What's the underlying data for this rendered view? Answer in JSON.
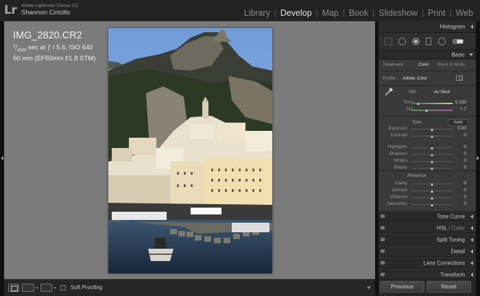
{
  "app": {
    "logo": "Lr",
    "name": "Adobe Lightroom Classic CC",
    "user": "Shannon Ciricillo"
  },
  "modules": [
    {
      "label": "Library",
      "active": false
    },
    {
      "label": "Develop",
      "active": true
    },
    {
      "label": "Map",
      "active": false
    },
    {
      "label": "Book",
      "active": false
    },
    {
      "label": "Slideshow",
      "active": false
    },
    {
      "label": "Print",
      "active": false
    },
    {
      "label": "Web",
      "active": false
    }
  ],
  "image_info": {
    "filename": "IMG_2820.CR2",
    "shutter_numerator": "1",
    "shutter_denominator": "4000",
    "exposure_rest": " sec at ƒ / 5.6, ISO 640",
    "lens": "50 mm (EF50mm f/1.8 STM)"
  },
  "toolbar": {
    "soft_proofing_label": "Soft Proofing",
    "soft_proofing_checked": false
  },
  "panel": {
    "histogram": "Histogram",
    "basic": "Basic",
    "treatment_label": "Treatment :",
    "treatment_options": [
      "Color",
      "Black & White"
    ],
    "treatment_selected": "Color",
    "profile_label": "Profile :",
    "profile_value": "Adobe Color",
    "wb_label": "WB :",
    "wb_value": "As Shot",
    "temp_label": "Temp",
    "temp_value": "5,150",
    "tint_label": "Tint",
    "tint_value": "+ 7",
    "tone_label": "Tone",
    "auto_label": "Auto",
    "tone_sliders": [
      {
        "label": "Exposure",
        "value": "0.00",
        "position": 0.5
      },
      {
        "label": "Contrast",
        "value": "0",
        "position": 0.5
      },
      {
        "label": "Highlights",
        "value": "0",
        "position": 0.5
      },
      {
        "label": "Shadows",
        "value": "0",
        "position": 0.5
      },
      {
        "label": "Whites",
        "value": "0",
        "position": 0.5
      },
      {
        "label": "Blacks",
        "value": "0",
        "position": 0.5
      }
    ],
    "presence_label": "Presence",
    "presence_sliders": [
      {
        "label": "Clarity",
        "value": "0",
        "position": 0.5
      },
      {
        "label": "Dehaze",
        "value": "0",
        "position": 0.5
      },
      {
        "label": "Vibrance",
        "value": "0",
        "position": 0.5
      },
      {
        "label": "Saturation",
        "value": "0",
        "position": 0.5
      }
    ],
    "collapsed_sections": [
      {
        "label": "Tone Curve",
        "dim": ""
      },
      {
        "label": "HSL",
        "dim": " / Color"
      },
      {
        "label": "Split Toning",
        "dim": ""
      },
      {
        "label": "Detail",
        "dim": ""
      },
      {
        "label": "Lens Corrections",
        "dim": ""
      },
      {
        "label": "Transform",
        "dim": ""
      }
    ]
  },
  "buttons": {
    "previous": "Previous",
    "reset": "Reset"
  },
  "colors": {
    "canvas_bg": "#7b7b7b",
    "panel_bg": "#3a3a3a",
    "active_module": "#e6e6e6"
  }
}
